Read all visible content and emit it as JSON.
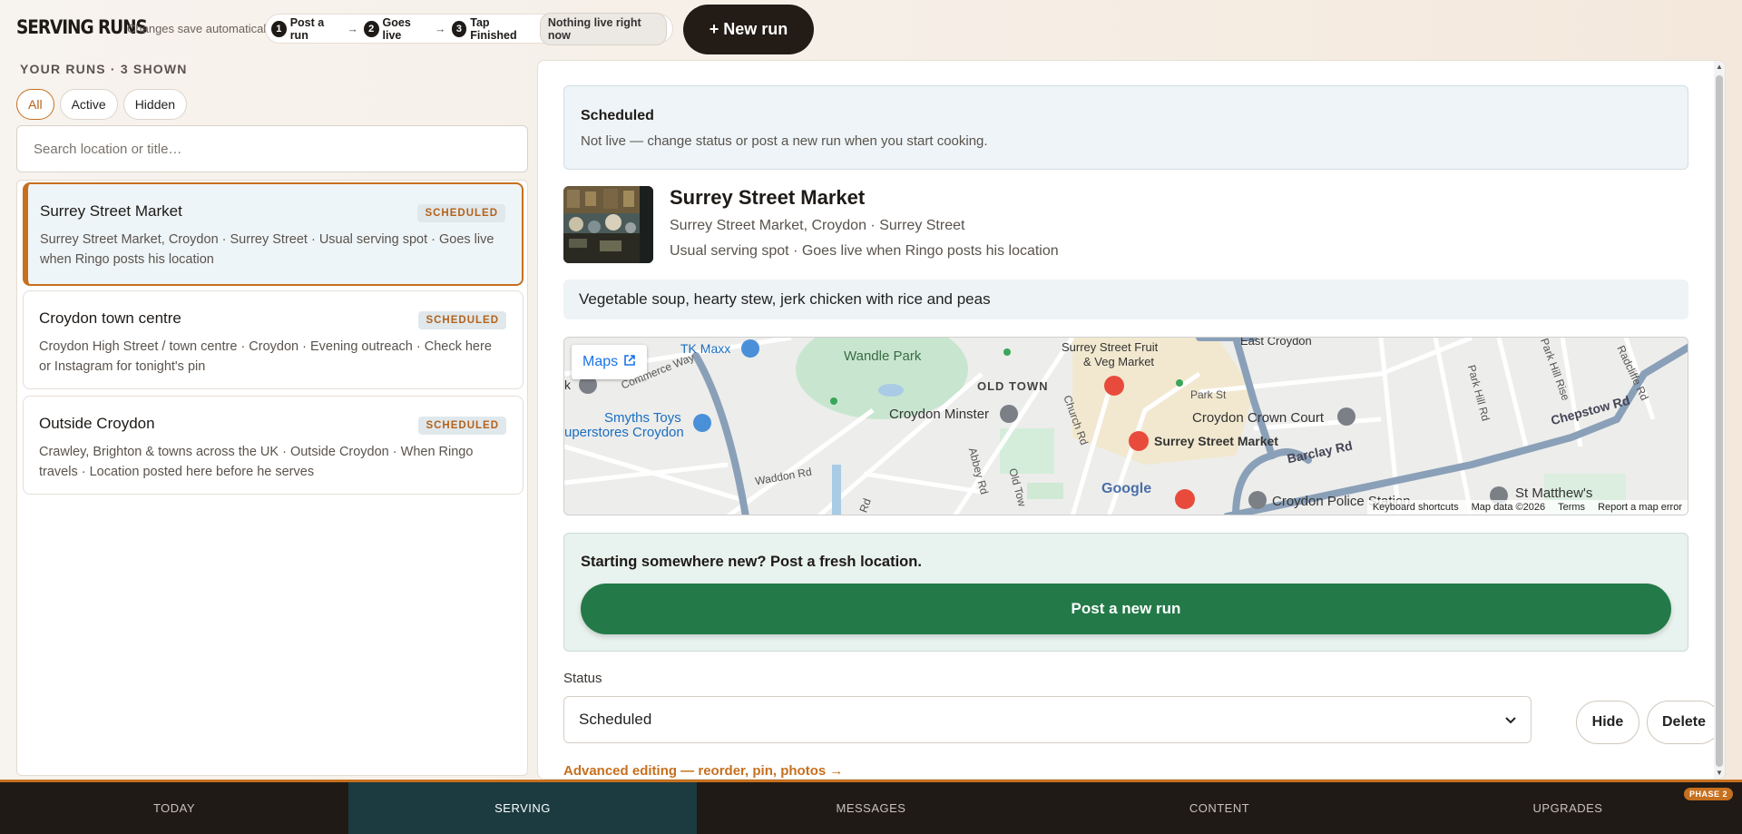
{
  "header": {
    "brand": "SERVING RUNS",
    "autosave": "Changes save automatically.",
    "steps": [
      {
        "num": "1",
        "label": "Post a run"
      },
      {
        "num": "2",
        "label": "Goes live"
      },
      {
        "num": "3",
        "label": "Tap Finished"
      }
    ],
    "arrow": "→",
    "live_status": "Nothing live right now",
    "new_run_label": "+ New run"
  },
  "sidebar": {
    "heading": "YOUR RUNS · 3 SHOWN",
    "filters": [
      "All",
      "Active",
      "Hidden"
    ],
    "active_filter": "All",
    "search_placeholder": "Search location or title…",
    "runs": [
      {
        "title": "Surrey Street Market",
        "badge": "SCHEDULED",
        "desc": "Surrey Street Market, Croydon · Surrey Street · Usual serving spot · Goes live when Ringo posts his location"
      },
      {
        "title": "Croydon town centre",
        "badge": "SCHEDULED",
        "desc": "Croydon High Street / town centre · Croydon · Evening outreach · Check here or Instagram for tonight's pin"
      },
      {
        "title": "Outside Croydon",
        "badge": "SCHEDULED",
        "desc": "Crawley, Brighton & towns across the UK · Outside Croydon · When Ringo travels · Location posted here before he serves"
      }
    ]
  },
  "detail": {
    "status_title": "Scheduled",
    "status_sub": "Not live — change status or post a new run when you start cooking.",
    "title": "Surrey Street Market",
    "line1": "Surrey Street Market, Croydon · Surrey Street",
    "line2": "Usual serving spot · Goes live when Ringo posts his location",
    "menu": "Vegetable soup, hearty stew, jerk chicken with rice and peas",
    "map": {
      "button": "Maps",
      "labels": {
        "tk_maxx": "TK Maxx",
        "wandle": "Wandle Park",
        "surrey_fruit": "Surrey Street Fruit",
        "veg_market": "& Veg Market",
        "east_croydon": "East Croydon",
        "commerce": "Commerce Way",
        "old_town": "OLD TOWN",
        "park_st": "Park St",
        "park_hill": "Park Hill Rd",
        "park_hill_rise": "Park Hill Rise",
        "radcliffe": "Radcliffe Rd",
        "smyths": "Smyths Toys",
        "superstores": "uperstores Croydon",
        "minster": "Croydon Minster",
        "church": "Church Rd",
        "crown_court": "Croydon Crown Court",
        "chepstow": "Chepstow Rd",
        "market": "Surrey Street Market",
        "barclay": "Barclay Rd",
        "waddon": "Waddon Rd",
        "abbey": "Abbey Rd",
        "old_town_rd": "Old Tow",
        "police": "Croydon Police Station",
        "st_matthews": "St Matthew's",
        "rd": "Rd",
        "google": "Google",
        "k": "k"
      },
      "footer": [
        "Keyboard shortcuts",
        "Map data ©2026",
        "Terms",
        "Report a map error"
      ]
    },
    "new_loc_text": "Starting somewhere new? Post a fresh location.",
    "post_button": "Post a new run",
    "status_label": "Status",
    "status_value": "Scheduled",
    "hide_label": "Hide",
    "delete_label": "Delete",
    "advanced_link": "Advanced editing — reorder, pin, photos →"
  },
  "nav": {
    "items": [
      "TODAY",
      "SERVING",
      "MESSAGES",
      "CONTENT",
      "UPGRADES"
    ],
    "active": "SERVING",
    "phase_badge": "PHASE 2"
  },
  "colors": {
    "accent": "#c6701f",
    "dark": "#231b16",
    "green": "#237a48",
    "nav_active": "#1b3b40"
  }
}
